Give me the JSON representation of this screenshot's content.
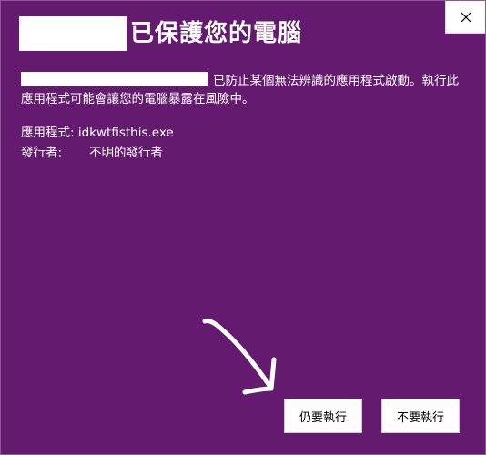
{
  "dialog": {
    "title": "已保護您的電腦",
    "message": "已防止某個無法辨識的應用程式啟動。執行此應用程式可能會讓您的電腦暴露在風險中。",
    "app_label": "應用程式:",
    "app_value": "idkwtfisthis.exe",
    "publisher_label": "發行者:",
    "publisher_value": "不明的發行者",
    "run_button": "仍要執行",
    "dont_run_button": "不要執行",
    "close_icon": "close-icon",
    "background_color": "#641a6e"
  }
}
